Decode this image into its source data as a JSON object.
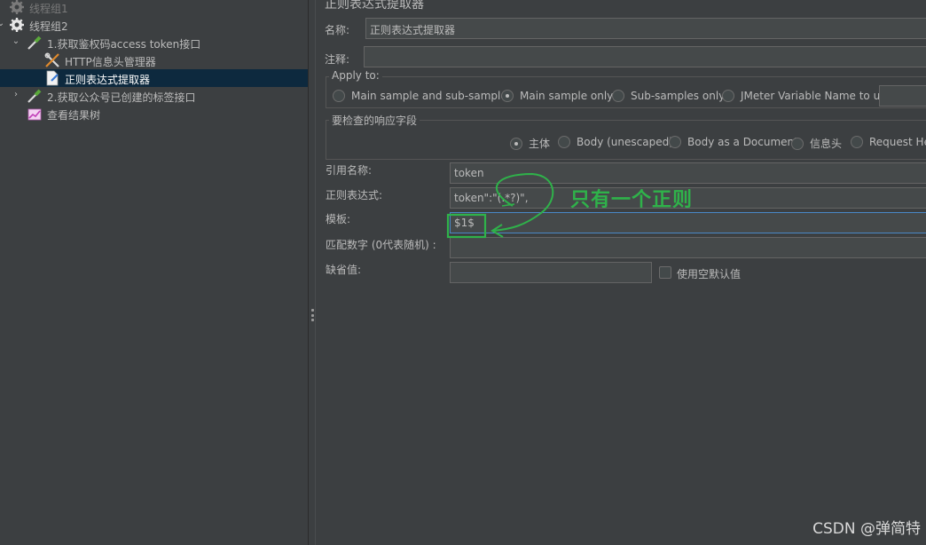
{
  "tree": {
    "items": [
      {
        "label": "线程组1",
        "icon": "gear-icon",
        "disabled": true
      },
      {
        "label": "线程组2",
        "icon": "gear-icon",
        "expanded": true
      },
      {
        "label": "1.获取鉴权码access token接口",
        "icon": "pipette-icon",
        "expanded": true
      },
      {
        "label": "HTTP信息头管理器",
        "icon": "wrench-icon"
      },
      {
        "label": "正则表达式提取器",
        "icon": "document-icon",
        "selected": true
      },
      {
        "label": "2.获取公众号已创建的标签接口",
        "icon": "pipette-icon"
      },
      {
        "label": "查看结果树",
        "icon": "chart-icon"
      }
    ]
  },
  "form": {
    "header": "正则表达式提取器",
    "name_label": "名称:",
    "name_value": "正则表达式提取器",
    "comment_label": "注释:",
    "comment_value": "",
    "apply_to": {
      "legend": "Apply to:",
      "options": [
        {
          "label": "Main sample and sub-samples",
          "selected": false
        },
        {
          "label": "Main sample only",
          "selected": true
        },
        {
          "label": "Sub-samples only",
          "selected": false
        },
        {
          "label": "JMeter Variable Name to use",
          "selected": false
        }
      ],
      "variable_value": ""
    },
    "response_field": {
      "legend": "要检查的响应字段",
      "options": [
        {
          "label": "主体",
          "selected": true
        },
        {
          "label": "Body (unescaped)",
          "selected": false
        },
        {
          "label": "Body as a Document",
          "selected": false
        },
        {
          "label": "信息头",
          "selected": false
        },
        {
          "label": "Request Hea",
          "selected": false
        }
      ]
    },
    "ref_name_label": "引用名称:",
    "ref_name_value": "token",
    "regex_label": "正则表达式:",
    "regex_value": "token\":\"(.*?)\",",
    "template_label": "模板:",
    "template_value": "$1$",
    "match_no_label": "匹配数字 (0代表随机) :",
    "match_no_value": "",
    "default_label": "缺省值:",
    "default_value": "",
    "use_empty_label": "使用空默认值",
    "use_empty_checked": false
  },
  "annotation": {
    "text": "只有一个正则",
    "color": "#2fb24a"
  },
  "watermark": "CSDN @弹简特"
}
